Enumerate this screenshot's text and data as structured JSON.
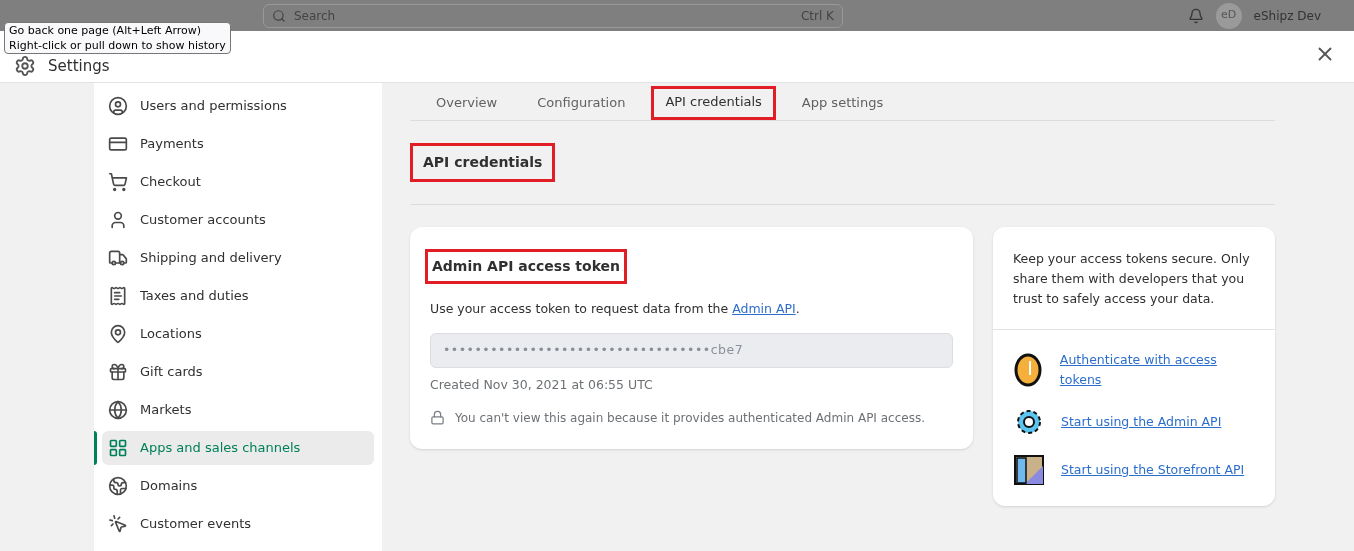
{
  "topbar": {
    "search": {
      "placeholder": "Search",
      "shortcut": "Ctrl K"
    },
    "account": {
      "initials": "eD",
      "name": "eShipz Dev"
    }
  },
  "tooltip": {
    "lines": [
      "Go back one page (Alt+Left Arrow)",
      "Right-click or pull down to show history"
    ]
  },
  "modal": {
    "title": "Settings"
  },
  "sidebar": {
    "items": [
      {
        "label": "Users and permissions",
        "selected": false
      },
      {
        "label": "Payments",
        "selected": false
      },
      {
        "label": "Checkout",
        "selected": false
      },
      {
        "label": "Customer accounts",
        "selected": false
      },
      {
        "label": "Shipping and delivery",
        "selected": false
      },
      {
        "label": "Taxes and duties",
        "selected": false
      },
      {
        "label": "Locations",
        "selected": false
      },
      {
        "label": "Gift cards",
        "selected": false
      },
      {
        "label": "Markets",
        "selected": false
      },
      {
        "label": "Apps and sales channels",
        "selected": true
      },
      {
        "label": "Domains",
        "selected": false
      },
      {
        "label": "Customer events",
        "selected": false
      }
    ]
  },
  "tabs": [
    {
      "label": "Overview",
      "selected": false,
      "highlighted": false
    },
    {
      "label": "Configuration",
      "selected": false,
      "highlighted": false
    },
    {
      "label": "API credentials",
      "selected": true,
      "highlighted": true
    },
    {
      "label": "App settings",
      "selected": false,
      "highlighted": false
    }
  ],
  "section": {
    "title": "API credentials",
    "highlighted": true
  },
  "token_card": {
    "title": "Admin API access token",
    "highlighted": true,
    "description": "Use your access token to request data from the ",
    "link": "Admin API",
    "description_end": ".",
    "token": "••••••••••••••••••••••••••••••••••cbe7",
    "created": "Created Nov 30, 2021 at 06:55 UTC",
    "notice": "You can't view this again because it provides authenticated Admin API access."
  },
  "help_card": {
    "text": "Keep your access tokens secure. Only share them with developers that you trust to safely access your data.",
    "links": [
      {
        "label": "Authenticate with access tokens"
      },
      {
        "label": "Start using the Admin API"
      },
      {
        "label": "Start using the Storefront API"
      }
    ]
  }
}
